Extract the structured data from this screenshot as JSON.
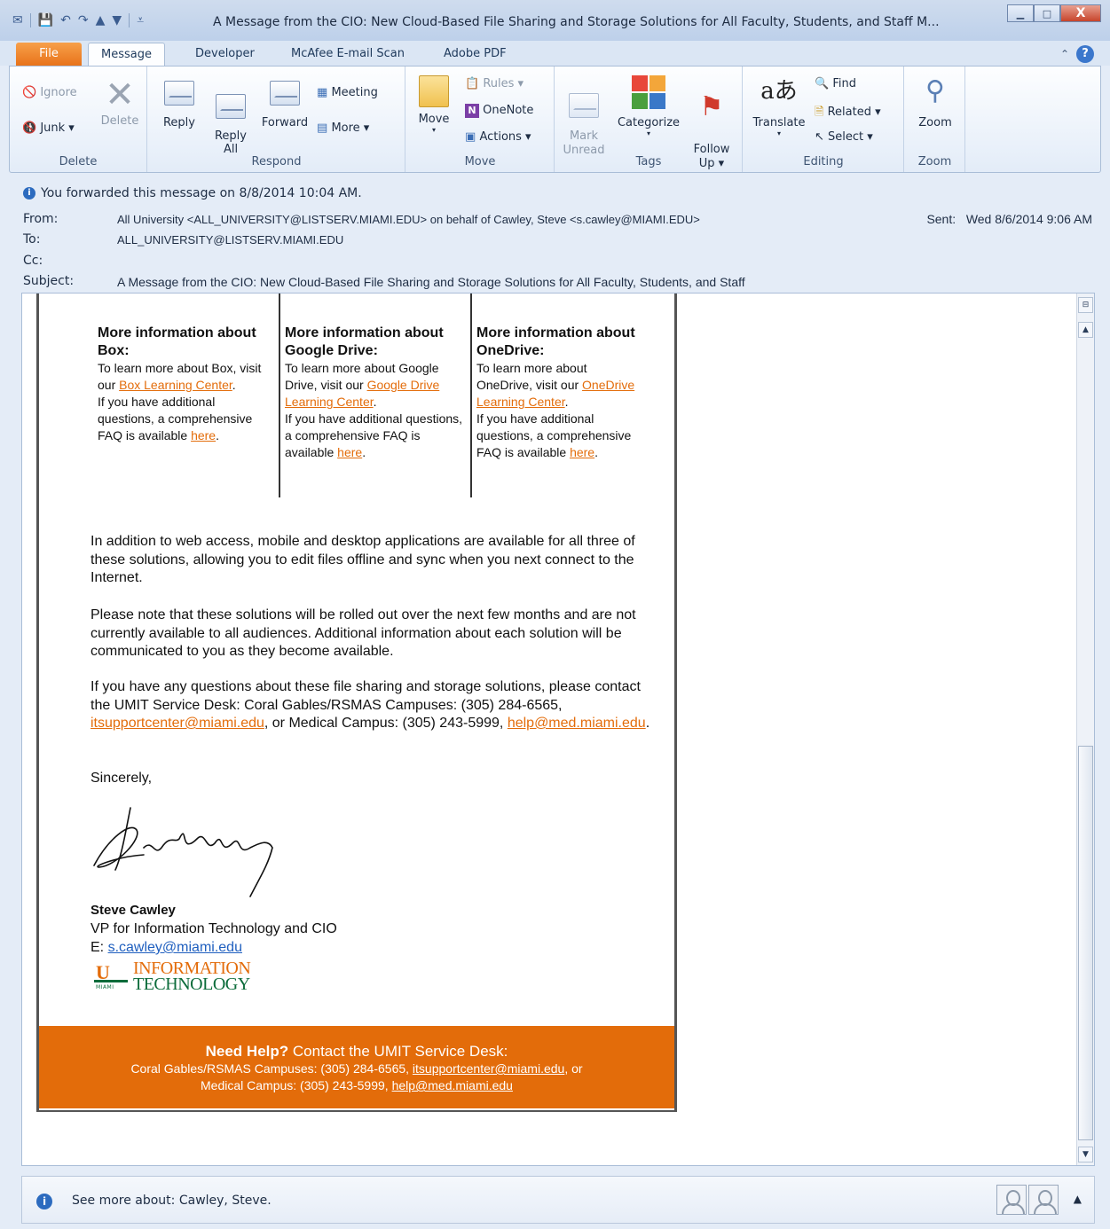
{
  "window": {
    "title": "A Message from the CIO: New Cloud-Based File Sharing and Storage Solutions for All Faculty, Students, and Staff M...",
    "controls": {
      "minimize": "▁",
      "maximize": "□",
      "close": "X"
    }
  },
  "tabs": {
    "file": "File",
    "message": "Message",
    "developer": "Developer",
    "mcafee": "McAfee E-mail Scan",
    "adobe": "Adobe PDF"
  },
  "ribbon": {
    "delete": {
      "label": "Delete",
      "ignore": "Ignore",
      "junk": "Junk ▾",
      "delete": "Delete"
    },
    "respond": {
      "label": "Respond",
      "reply": "Reply",
      "reply_all": "Reply\nAll",
      "forward": "Forward",
      "meeting": "Meeting",
      "more": "More ▾"
    },
    "move": {
      "label": "Move",
      "move": "Move",
      "rules": "Rules ▾",
      "onenote": "OneNote",
      "actions": "Actions ▾"
    },
    "tags": {
      "label": "Tags",
      "mark_unread": "Mark\nUnread",
      "categorize": "Categorize",
      "follow_up": "Follow\nUp ▾"
    },
    "editing": {
      "label": "Editing",
      "translate": "Translate",
      "find": "Find",
      "related": "Related ▾",
      "select": "Select ▾"
    },
    "zoom": {
      "label": "Zoom",
      "zoom": "Zoom"
    }
  },
  "header": {
    "info": "You forwarded this message on 8/8/2014 10:04 AM.",
    "from_label": "From:",
    "from": "All University <ALL_UNIVERSITY@LISTSERV.MIAMI.EDU> on behalf of Cawley, Steve <s.cawley@MIAMI.EDU>",
    "to_label": "To:",
    "to": "ALL_UNIVERSITY@LISTSERV.MIAMI.EDU",
    "cc_label": "Cc:",
    "subject_label": "Subject:",
    "subject": "A Message from the CIO: New Cloud-Based File Sharing and Storage Solutions for All Faculty, Students, and Staff",
    "sent_label": "Sent:",
    "sent": "Wed 8/6/2014 9:06 AM"
  },
  "body": {
    "col1": {
      "heading": "More information about Box:",
      "t1": "To learn more about Box, visit our ",
      "link1": "Box Learning Center",
      "t2": ".",
      "t3": "If you have additional questions, a comprehensive FAQ is available ",
      "link2": "here",
      "t4": "."
    },
    "col2": {
      "heading": "More information about Google Drive:",
      "t1": "To learn more about Google Drive, visit our ",
      "link1": "Google Drive Learning Center",
      "t2": ".",
      "t3": "If you have additional questions, a comprehensive FAQ is available ",
      "link2": "here",
      "t4": "."
    },
    "col3": {
      "heading": "More information about OneDrive:",
      "t1": "To learn more about OneDrive, visit our ",
      "link1": "OneDrive Learning Center",
      "t2": ".",
      "t3": "If you have additional questions, a comprehensive FAQ is available ",
      "link2": "here",
      "t4": "."
    },
    "p1": "In addition to web access, mobile and desktop applications are available for all three of these solutions, allowing you to edit files offline and sync when you next connect to the Internet.",
    "p2": "Please note that these solutions will be rolled out over the next few months and are not currently available to all audiences. Additional information about each solution will be communicated to you as they become available.",
    "p3a": "If you have any questions about these file sharing and storage solutions, please contact the UMIT Service Desk: Coral Gables/RSMAS Campuses: (305) 284-6565, ",
    "p3_link1": "itsupportcenter@miami.edu",
    "p3b": ", or Medical Campus: (305) 243-5999, ",
    "p3_link2": "help@med.miami.edu",
    "p3c": ".",
    "closing": "Sincerely,",
    "sig_name": "Steve Cawley",
    "sig_title": "VP for Information Technology and CIO",
    "sig_email_prefix": "E: ",
    "sig_email": "s.cawley@miami.edu",
    "logo": {
      "u": "U",
      "miami": "MIAMI",
      "line1": "INFORMATION",
      "line2": "TECHNOLOGY"
    },
    "footer": {
      "bold": "Need Help?",
      "title": " Contact the UMIT Service Desk:",
      "line2a": "Coral Gables/RSMAS Campuses: (305) 284-6565, ",
      "line2_link": "itsupportcenter@miami.edu",
      "line2b": ", or",
      "line3a": "Medical Campus: (305) 243-5999, ",
      "line3_link": "help@med.miami.edu"
    }
  },
  "people_pane": {
    "text": "See more about: Cawley, Steve."
  },
  "colors": {
    "accent_orange": "#e36c0a",
    "um_green": "#0b6b3a",
    "link_blue": "#1f5fbf"
  }
}
